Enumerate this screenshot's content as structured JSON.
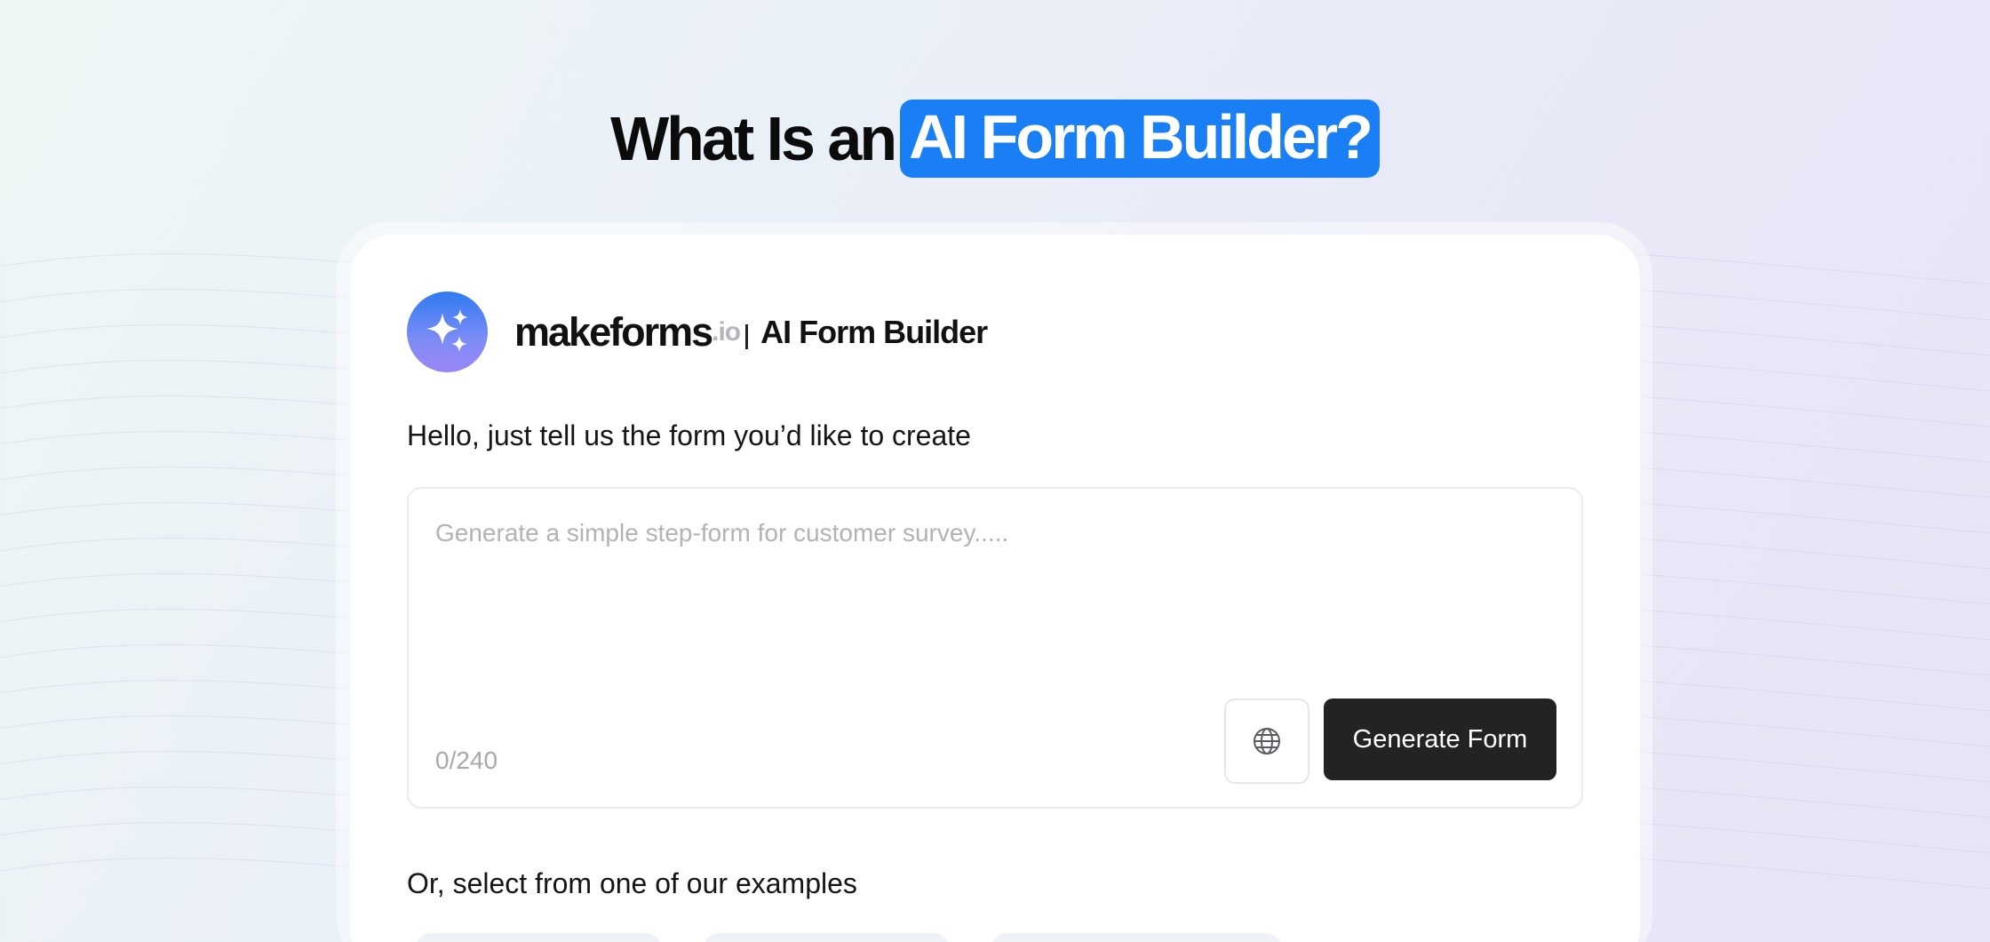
{
  "headline": {
    "prefix": "What Is an",
    "highlight": "AI Form Builder?"
  },
  "brand": {
    "name": "makeforms",
    "suffix": ".io",
    "product": "AI Form Builder",
    "logo_icon": "sparkles-icon"
  },
  "prompt": {
    "label": "Hello, just tell us the form you’d like to create",
    "placeholder": "Generate a simple step-form for customer survey.....",
    "value": "",
    "counter": "0/240"
  },
  "actions": {
    "language_icon": "globe-icon",
    "generate_label": "Generate Form"
  },
  "examples": {
    "label": "Or, select from one of our examples"
  },
  "colors": {
    "accent": "#1a7ff5",
    "button_dark": "#222325",
    "logo_gradient_top": "#2f7bf2",
    "logo_gradient_bottom": "#9b86f5"
  }
}
